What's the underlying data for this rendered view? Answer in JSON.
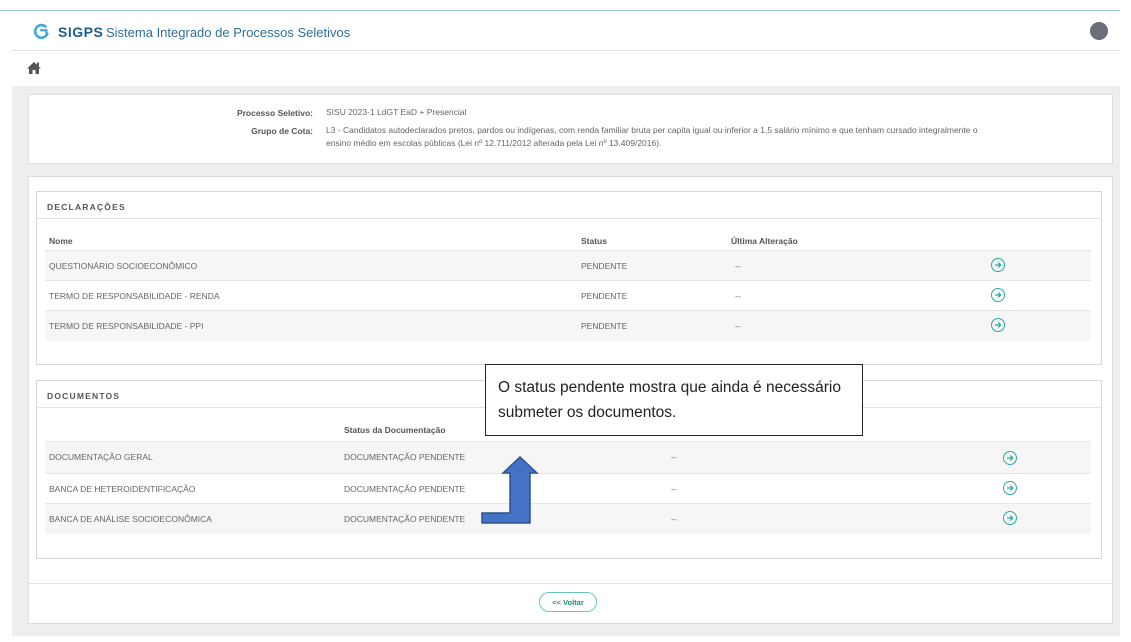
{
  "header": {
    "brand": "SIGPS",
    "system_name": "Sistema Integrado de Processos Seletivos"
  },
  "info": {
    "processo_label": "Processo Seletivo:",
    "processo_value": "SISU 2023-1 LdGT EaD + Presencial",
    "cota_label": "Grupo de Cota:",
    "cota_value_line1": "L3 - Candidatos autodeclarados pretos, pardos ou indígenas, com renda familiar bruta per capita igual ou inferior a 1,5 salário mínimo e que tenham cursado integralmente o",
    "cota_value_line2": "ensino médio em escolas públicas (Lei nº 12.711/2012 alterada pela Lei nº 13.409/2016)."
  },
  "declaracoes": {
    "title": "DECLARAÇÕES",
    "columns": {
      "nome": "Nome",
      "status": "Status",
      "ultima": "Última Alteração"
    },
    "rows": [
      {
        "nome": "QUESTIONÁRIO SOCIOECONÔMICO",
        "status": "PENDENTE",
        "ultima": "--"
      },
      {
        "nome": "TERMO DE RESPONSABILIDADE - RENDA",
        "status": "PENDENTE",
        "ultima": "--"
      },
      {
        "nome": "TERMO DE RESPONSABILIDADE - PPI",
        "status": "PENDENTE",
        "ultima": "--"
      }
    ]
  },
  "documentos": {
    "title": "DOCUMENTOS",
    "columns": {
      "status": "Status da Documentação"
    },
    "rows": [
      {
        "nome": "DOCUMENTAÇÃO GERAL",
        "status": "DOCUMENTAÇÃO PENDENTE",
        "ultima": "--"
      },
      {
        "nome": "BANCA DE HETEROIDENTIFICAÇÃO",
        "status": "DOCUMENTAÇÃO PENDENTE",
        "ultima": "--"
      },
      {
        "nome": "BANCA DE ANÁLISE SOCIOECONÔMICA",
        "status": "DOCUMENTAÇÃO PENDENTE",
        "ultima": "--"
      }
    ]
  },
  "footer": {
    "voltar_label": "<< Voltar"
  },
  "annotation": {
    "text": "O status pendente mostra que ainda é necessário submeter os documentos."
  },
  "icons": {
    "logo": "sigps-logo-icon",
    "home": "home-icon",
    "avatar": "user-avatar",
    "row_action": "arrow-right-circle-icon",
    "annotation_arrow": "up-arrow-icon"
  },
  "colors": {
    "brand": "#1e5d8a",
    "accent": "#2aa9a0",
    "annotation_arrow": "#4472c4"
  }
}
